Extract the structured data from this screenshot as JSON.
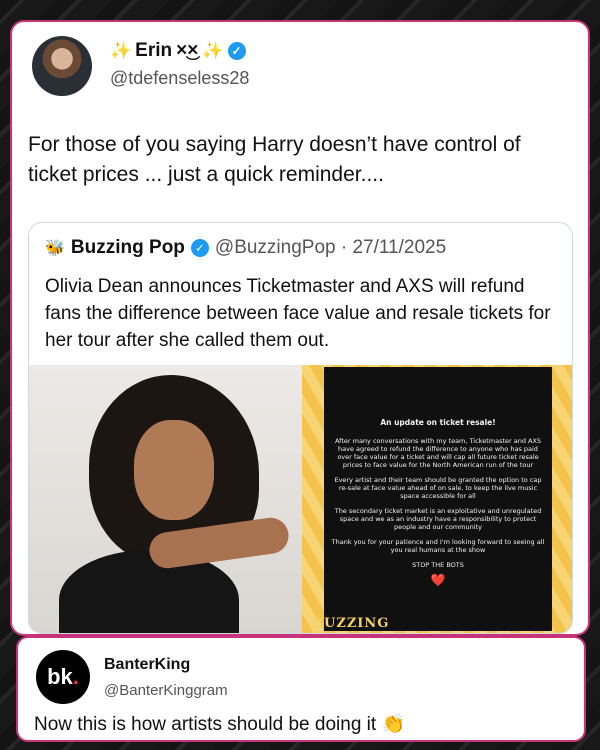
{
  "tweet": {
    "display_name": "Erin",
    "name_emoji": "×͜×",
    "sparkle_left": "✨",
    "sparkle_right": "✨",
    "handle": "@tdefenseless28",
    "text": "For those of you saying Harry doesn’t have control of ticket prices ... just a quick reminder...."
  },
  "quote": {
    "name": "Buzzing Pop",
    "handle_date": "@BuzzingPop · 27/11/2025",
    "text": "Olivia Dean announces Ticketmaster and AXS will refund fans the difference between face value and resale tickets for her tour after she called them out.",
    "watermark": "BUZZING"
  },
  "story": {
    "title": "An update on ticket resale!",
    "p1": "After many conversations with my team, Ticketmaster and AXS have agreed to refund the difference to anyone who has paid over face value for a ticket and will cap all future ticket resale prices to face value for the North American run of the tour",
    "p2": "Every artist and their team should be granted the option to cap re-sale at face value ahead of on sale, to keep the live music space accessible for all",
    "p3": "The secondary ticket market is an exploitative and unregulated space and we as an industry have a responsibility to protect people and our community",
    "p4": "Thank you for your patience and I'm looking forward to seeing all you real humans at the show",
    "p5": "STOP THE BOTS",
    "heart": "❤️"
  },
  "reply": {
    "logo_text": "bk",
    "logo_dot": ".",
    "name": "BanterKing",
    "handle": "@BanterKinggram",
    "text": "Now this is how artists should be doing it 👏"
  },
  "icons": {
    "verified": "verified-badge",
    "bee": "bee-icon"
  },
  "colors": {
    "accent_border": "#c6337a",
    "verified": "#1d9bf0"
  }
}
